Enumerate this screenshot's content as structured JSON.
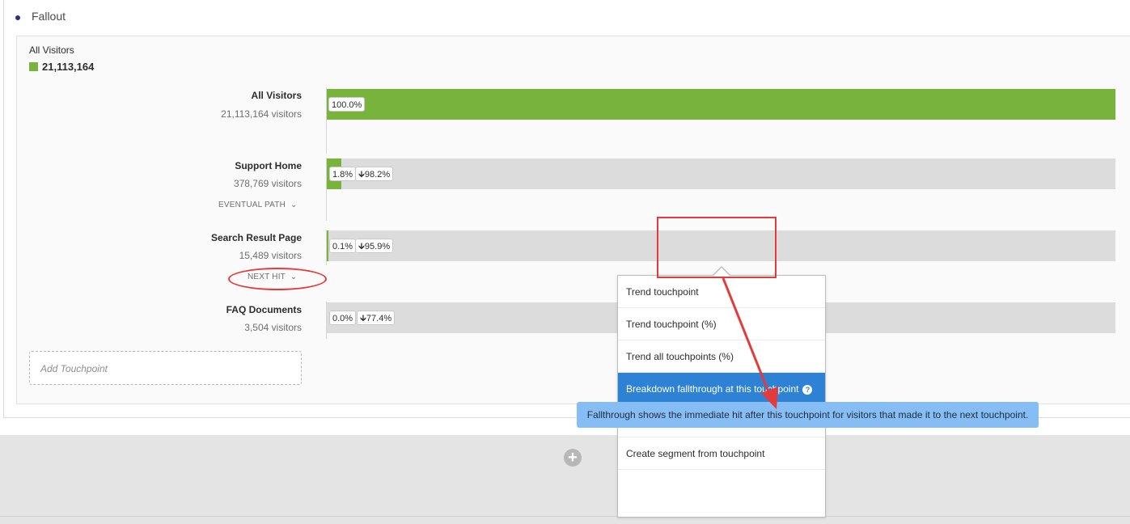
{
  "panel": {
    "title": "Fallout"
  },
  "segment": {
    "name": "All Visitors",
    "total": "21,113,164",
    "color": "#78b43c"
  },
  "touchpoints": [
    {
      "name": "All Visitors",
      "visitors": "21,113,164 visitors",
      "percent_label": "100.0%",
      "fill_fraction": 1.0
    },
    {
      "name": "Support Home",
      "visitors": "378,769 visitors",
      "percent_label": "1.8%",
      "dropoff_label": "98.2%",
      "fill_fraction": 0.018,
      "path_link": "EVENTUAL PATH"
    },
    {
      "name": "Search Result Page",
      "visitors": "15,489 visitors",
      "percent_label": "0.1%",
      "dropoff_label": "95.9%",
      "fill_fraction": 0.001,
      "path_link": "NEXT HIT"
    },
    {
      "name": "FAQ Documents",
      "visitors": "3,504 visitors",
      "percent_label": "0.0%",
      "dropoff_label": "77.4%",
      "fill_fraction": 0.0
    }
  ],
  "add_touchpoint": {
    "placeholder": "Add Touchpoint"
  },
  "context_menu": {
    "items": [
      {
        "label": "Trend touchpoint"
      },
      {
        "label": "Trend touchpoint (%)"
      },
      {
        "label": "Trend all touchpoints (%)"
      },
      {
        "label": "Breakdown fallthrough at this touchpoint",
        "active": true,
        "help_icon": "?"
      },
      {
        "label": ""
      },
      {
        "label": "Create segment from touchpoint"
      }
    ]
  },
  "tooltip": {
    "text": "Fallthrough shows the immediate hit after this touchpoint for visitors that made it to the next touchpoint."
  },
  "colors": {
    "accent_green": "#78b43c",
    "menu_active": "#2d82d6",
    "tooltip_bg": "#86bdf4",
    "annotation_red": "#e23b3b"
  }
}
